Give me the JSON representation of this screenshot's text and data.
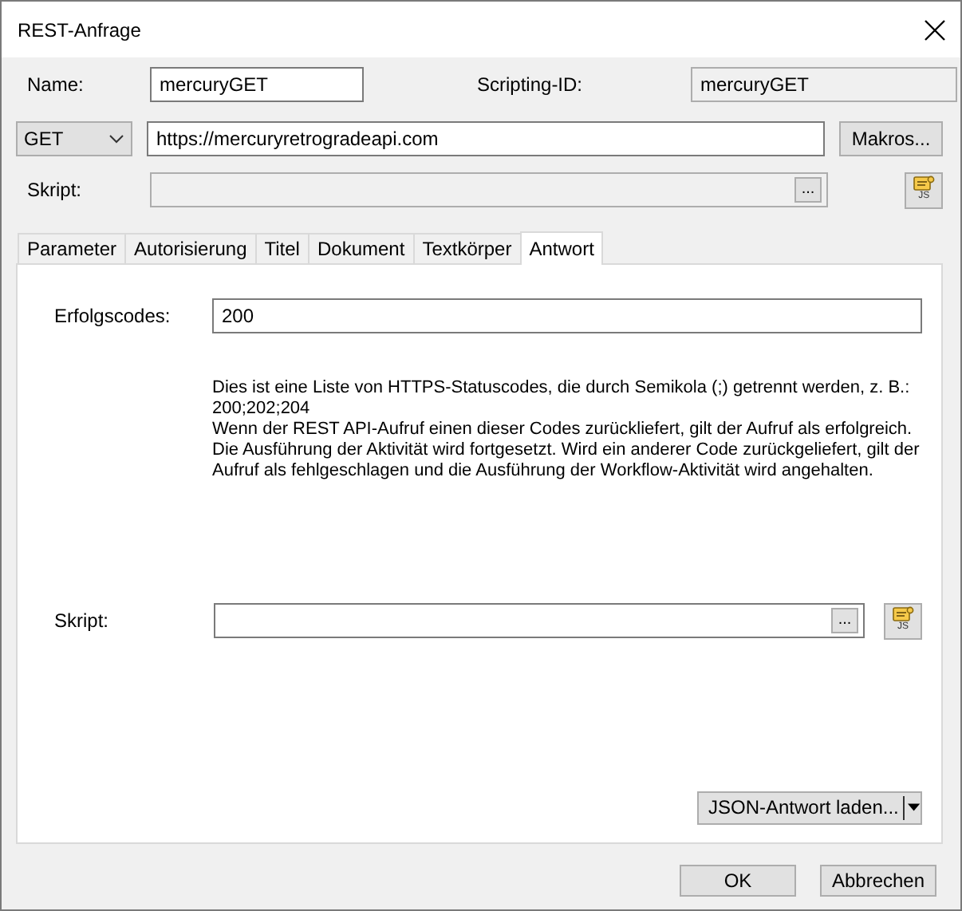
{
  "window": {
    "title": "REST-Anfrage"
  },
  "name": {
    "label": "Name:",
    "value": "mercuryGET"
  },
  "scripting_id": {
    "label": "Scripting-ID:",
    "value": "mercuryGET"
  },
  "method": {
    "value": "GET"
  },
  "url": {
    "value": "https://mercuryretrogradeapi.com"
  },
  "macros_button": "Makros...",
  "script": {
    "label": "Skript:",
    "browse": "...",
    "editor_label": "JS",
    "disabled": true
  },
  "tabs": [
    {
      "label": "Parameter",
      "selected": false
    },
    {
      "label": "Autorisierung",
      "selected": false
    },
    {
      "label": "Titel",
      "selected": false
    },
    {
      "label": "Dokument",
      "selected": false
    },
    {
      "label": "Textkörper",
      "selected": false
    },
    {
      "label": "Antwort",
      "selected": true
    }
  ],
  "response": {
    "success_codes": {
      "label": "Erfolgscodes:",
      "value": "200"
    },
    "description": [
      "Dies ist eine Liste von HTTPS-Statuscodes, die durch Semikola (;) getrennt werden, z. B.:",
      "200;202;204",
      "Wenn der REST API-Aufruf einen dieser Codes zurückliefert, gilt der Aufruf als erfolgreich.",
      "Die Ausführung der Aktivität wird fortgesetzt. Wird ein anderer Code zurückgeliefert, gilt der",
      "Aufruf als fehlgeschlagen und die Ausführung der Workflow-Aktivität wird angehalten."
    ],
    "script": {
      "label": "Skript:",
      "browse": "...",
      "editor_label": "JS",
      "disabled": false
    },
    "load_button": "JSON-Antwort laden..."
  },
  "buttons": [
    "OK",
    "Abbrechen"
  ]
}
